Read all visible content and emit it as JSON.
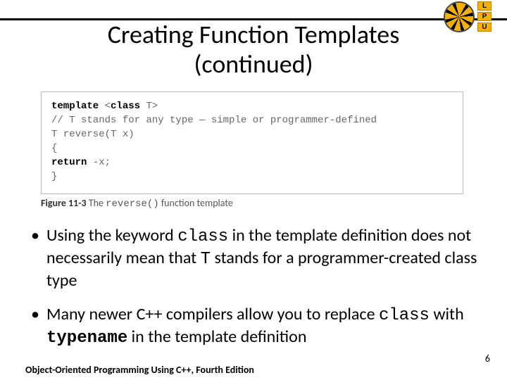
{
  "logo": {
    "l": "L",
    "p": "P",
    "u": "U"
  },
  "title": {
    "line1": "Creating Function Templates",
    "line2": "(continued)"
  },
  "code": {
    "l1_kw1": "template",
    "l1_sp": " ",
    "l1_lt": "<",
    "l1_kw2": "class",
    "l1_rest": " T>",
    "l2": "// T stands for any type — simple or programmer-defined",
    "l3": "T reverse(T x)",
    "l4": "{",
    "l5_pre": "    ",
    "l5_kw": "return",
    "l5_rest": " -x;",
    "l6": "}"
  },
  "figcap": {
    "label": "Figure 11-3",
    "pre": " The ",
    "code": "reverse()",
    "post": " function template"
  },
  "bullets": {
    "b1_a": "Using the keyword ",
    "b1_code1": "class",
    "b1_b": " in the template definition does not necessarily mean that ",
    "b1_code2": "T",
    "b1_c": " stands for a programmer-created class type",
    "b2_a": "Many newer C++ compilers allow you to replace ",
    "b2_code1": "class",
    "b2_b": " with ",
    "b2_code2": "typename",
    "b2_c": " in the template definition"
  },
  "pagenum": "6",
  "footer": "Object-Oriented Programming Using C++, Fourth Edition"
}
